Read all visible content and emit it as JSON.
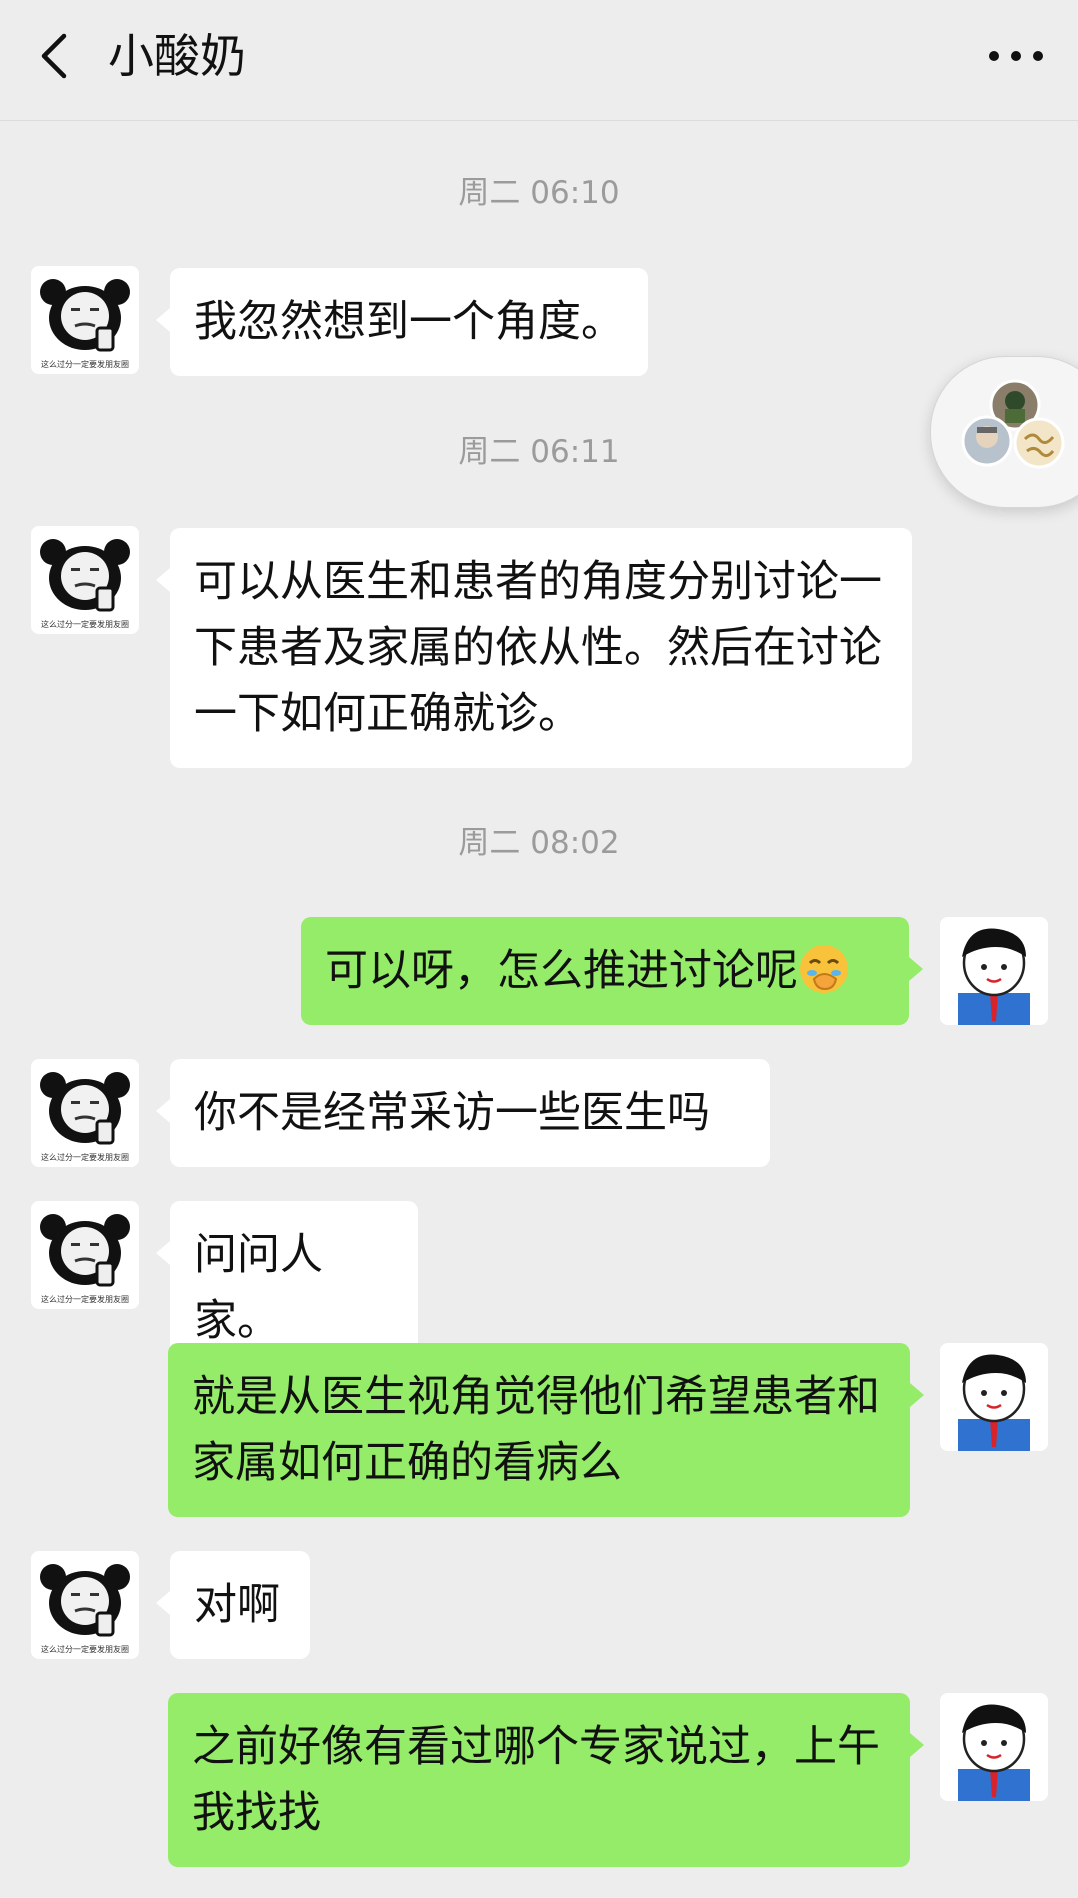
{
  "header": {
    "title": "小酸奶"
  },
  "timestamps": [
    "周二 06:10",
    "周二 06:11",
    "周二 08:02"
  ],
  "messages": [
    {
      "side": "in",
      "text": "我忽然想到一个角度。"
    },
    {
      "side": "in",
      "text": "可以从医生和患者的角度分别讨论一下患者及家属的依从性。然后在讨论一下如何正确就诊。"
    },
    {
      "side": "out",
      "text": "可以呀，怎么推进讨论呢",
      "emoji": "face-with-hand-over-mouth-emoji"
    },
    {
      "side": "in",
      "text": "你不是经常采访一些医生吗"
    },
    {
      "side": "in",
      "text": "问问人家。"
    },
    {
      "side": "out",
      "text": "就是从医生视角觉得他们希望患者和家属如何正确的看病么"
    },
    {
      "side": "in",
      "text": "对啊"
    },
    {
      "side": "out",
      "text": "之前好像有看过哪个专家说过，上午我找找"
    }
  ],
  "avatar_caption": "这么过分一定要发朋友圈",
  "colors": {
    "background": "#ededed",
    "incoming_bubble": "#ffffff",
    "outgoing_bubble": "#95ec69",
    "timestamp": "#9b9b9b"
  },
  "icons": {
    "back": "chevron-left-icon",
    "more": "more-dots-icon"
  }
}
